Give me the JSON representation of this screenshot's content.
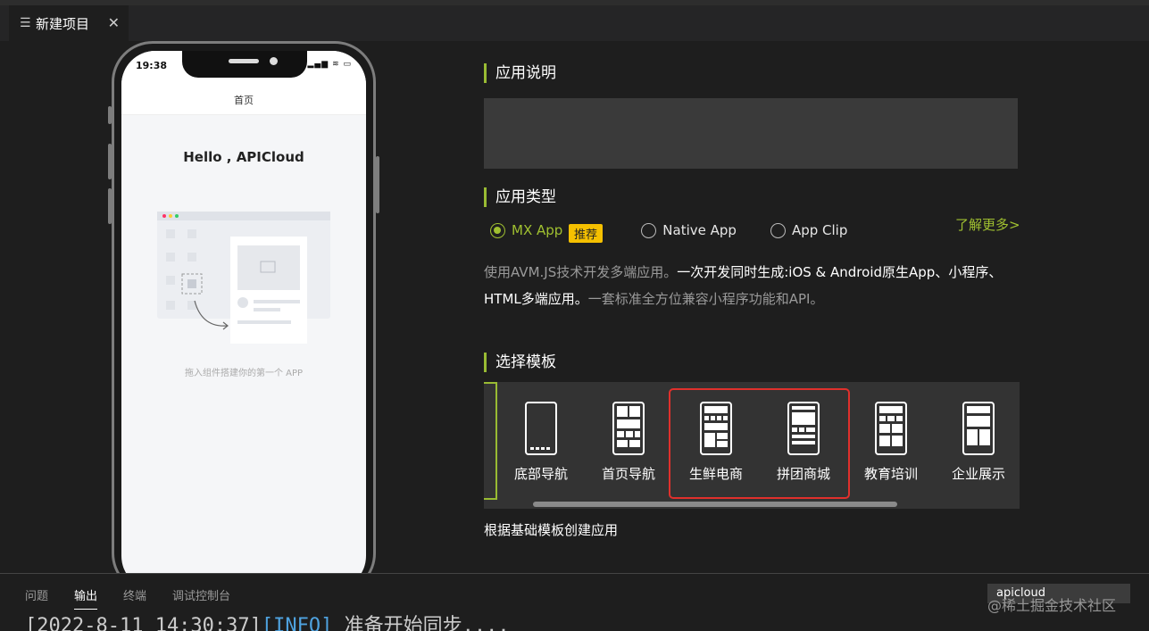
{
  "tab": {
    "title": "新建项目",
    "icon": "list-icon"
  },
  "phone": {
    "time": "19:38",
    "nav_title": "首页",
    "hello": "Hello , APICloud",
    "drag_tip": "拖入组件搭建你的第一个 APP"
  },
  "sections": {
    "desc_title": "应用说明",
    "type_title": "应用类型",
    "template_title": "选择模板"
  },
  "app_types": [
    {
      "label": "MX App",
      "checked": true
    },
    {
      "label": "Native App",
      "checked": false
    },
    {
      "label": "App Clip",
      "checked": false
    }
  ],
  "badge": "推荐",
  "learn_more": "了解更多>",
  "type_desc": {
    "p1": "使用AVM.JS技术开发多端应用。",
    "p2": "一次开发同时生成:iOS & Android原生App、小程序、HTML多端应用。",
    "p3": "一套标准全方位兼容小程序功能和API。"
  },
  "templates": [
    {
      "label": "底部导航"
    },
    {
      "label": "首页导航"
    },
    {
      "label": "生鲜电商"
    },
    {
      "label": "拼团商城"
    },
    {
      "label": "教育培训"
    },
    {
      "label": "企业展示"
    }
  ],
  "template_caption": "根据基础模板创建应用",
  "panel": {
    "tabs": [
      "问题",
      "输出",
      "终端",
      "调试控制台"
    ],
    "active_tab": "输出",
    "channel": "apicloud",
    "log_time": "[2022-8-11 14:30:37]",
    "log_level": "[INFO]",
    "log_msg": " 准备开始同步....",
    "watermark": "@稀土掘金技术社区"
  },
  "colors": {
    "accent": "#a0c030",
    "badge": "#f5c000",
    "highlight_box": "#e0302c",
    "info": "#4fa3e0"
  }
}
